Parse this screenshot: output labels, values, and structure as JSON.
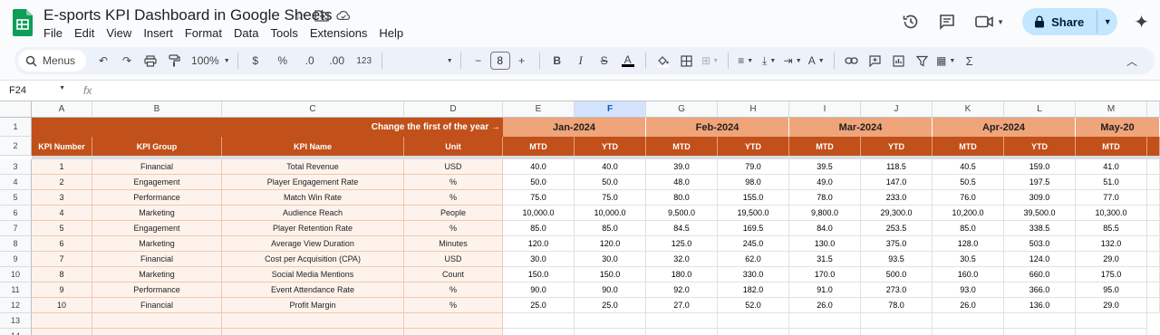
{
  "app": {
    "doc_title": "E-sports KPI Dashboard in Google Sheets",
    "menu": [
      "File",
      "Edit",
      "View",
      "Insert",
      "Format",
      "Data",
      "Tools",
      "Extensions",
      "Help"
    ],
    "share_label": "Share",
    "accent_color": "#c2e7ff"
  },
  "toolbar": {
    "search_label": "Menus",
    "zoom": "100%",
    "currency": "$",
    "percent": "%",
    "dec_decrease": ".0",
    "dec_increase": ".00",
    "number_format": "123",
    "font_size": "8"
  },
  "formula_bar": {
    "name_box": "F24",
    "fx": "fx"
  },
  "sheet": {
    "selected_column": "F",
    "column_letters": [
      "A",
      "B",
      "C",
      "D",
      "E",
      "F",
      "G",
      "H",
      "I",
      "J",
      "K",
      "L",
      "M"
    ],
    "row_numbers": [
      "1",
      "2",
      "3",
      "4",
      "5",
      "6",
      "7",
      "8",
      "9",
      "10",
      "11",
      "12",
      "13",
      "14"
    ],
    "banner_text": "Change the first of the year →",
    "months": [
      "Jan-2024",
      "Feb-2024",
      "Mar-2024",
      "Apr-2024",
      "May-20"
    ],
    "headers": {
      "kpi_number": "KPI Number",
      "kpi_group": "KPI Group",
      "kpi_name": "KPI Name",
      "unit": "Unit",
      "mtd": "MTD",
      "ytd": "YTD"
    },
    "colors": {
      "dark_orange": "#c1501a",
      "light_orange": "#f0a47a",
      "left_fill": "#fdf3ec"
    },
    "rows": [
      [
        "1",
        "Financial",
        "Total Revenue",
        "USD",
        "40.0",
        "40.0",
        "39.0",
        "79.0",
        "39.5",
        "118.5",
        "40.5",
        "159.0",
        "41.0"
      ],
      [
        "2",
        "Engagement",
        "Player Engagement Rate",
        "%",
        "50.0",
        "50.0",
        "48.0",
        "98.0",
        "49.0",
        "147.0",
        "50.5",
        "197.5",
        "51.0"
      ],
      [
        "3",
        "Performance",
        "Match Win Rate",
        "%",
        "75.0",
        "75.0",
        "80.0",
        "155.0",
        "78.0",
        "233.0",
        "76.0",
        "309.0",
        "77.0"
      ],
      [
        "4",
        "Marketing",
        "Audience Reach",
        "People",
        "10,000.0",
        "10,000.0",
        "9,500.0",
        "19,500.0",
        "9,800.0",
        "29,300.0",
        "10,200.0",
        "39,500.0",
        "10,300.0"
      ],
      [
        "5",
        "Engagement",
        "Player Retention Rate",
        "%",
        "85.0",
        "85.0",
        "84.5",
        "169.5",
        "84.0",
        "253.5",
        "85.0",
        "338.5",
        "85.5"
      ],
      [
        "6",
        "Marketing",
        "Average View Duration",
        "Minutes",
        "120.0",
        "120.0",
        "125.0",
        "245.0",
        "130.0",
        "375.0",
        "128.0",
        "503.0",
        "132.0"
      ],
      [
        "7",
        "Financial",
        "Cost per Acquisition (CPA)",
        "USD",
        "30.0",
        "30.0",
        "32.0",
        "62.0",
        "31.5",
        "93.5",
        "30.5",
        "124.0",
        "29.0"
      ],
      [
        "8",
        "Marketing",
        "Social Media Mentions",
        "Count",
        "150.0",
        "150.0",
        "180.0",
        "330.0",
        "170.0",
        "500.0",
        "160.0",
        "660.0",
        "175.0"
      ],
      [
        "9",
        "Performance",
        "Event Attendance Rate",
        "%",
        "90.0",
        "90.0",
        "92.0",
        "182.0",
        "91.0",
        "273.0",
        "93.0",
        "366.0",
        "95.0"
      ],
      [
        "10",
        "Financial",
        "Profit Margin",
        "%",
        "25.0",
        "25.0",
        "27.0",
        "52.0",
        "26.0",
        "78.0",
        "26.0",
        "136.0",
        "29.0"
      ]
    ]
  }
}
